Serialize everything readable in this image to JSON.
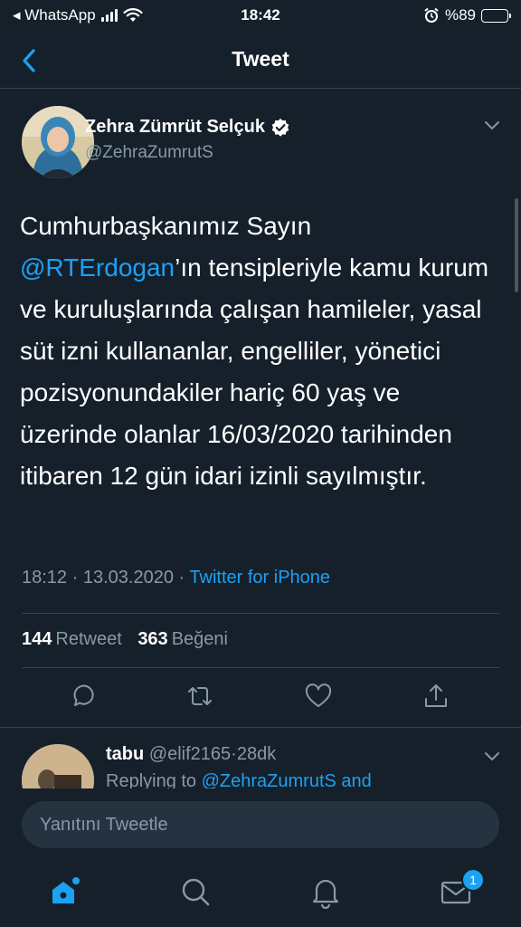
{
  "status_bar": {
    "carrier": "◂ WhatsApp",
    "time": "18:42",
    "battery_text": "%89",
    "battery_level": 0.89
  },
  "header": {
    "title": "Tweet"
  },
  "tweet": {
    "author_name": "Zehra Zümrüt Selçuk",
    "author_handle": "@ZehraZumrutS",
    "verified": true,
    "text_before": "Cumhurbaşkanımız Sayın ",
    "mention": "@RTErdogan",
    "text_after": "’ın tensipleriyle kamu kurum ve kuruluşlarında çalışan hamileler, yasal süt izni kullananlar, engelliler, yönetici pozisyonundakiler hariç 60 yaş ve üzerinde olanlar 16/03/2020 tarihinden itibaren 12 gün idari izinli sayılmıştır.",
    "time": "18:12",
    "date": "13.03.2020",
    "separator": "·",
    "source": "Twitter for iPhone",
    "retweet_count": "144",
    "retweet_label": "Retweet",
    "like_count": "363",
    "like_label": "Beğeni"
  },
  "reply": {
    "name": "tabu",
    "handle": "@elif2165",
    "separator": "·",
    "age": "28dk",
    "replying_prefix": "Replying to ",
    "replying_mention": "@ZehraZumrutS and"
  },
  "compose": {
    "placeholder": "Yanıtını Tweetle"
  },
  "tabbar": {
    "messages_badge": "1"
  },
  "colors": {
    "background": "#15202b",
    "accent": "#1da1f2",
    "secondary_text": "#8899a6",
    "divider": "#38444d"
  }
}
